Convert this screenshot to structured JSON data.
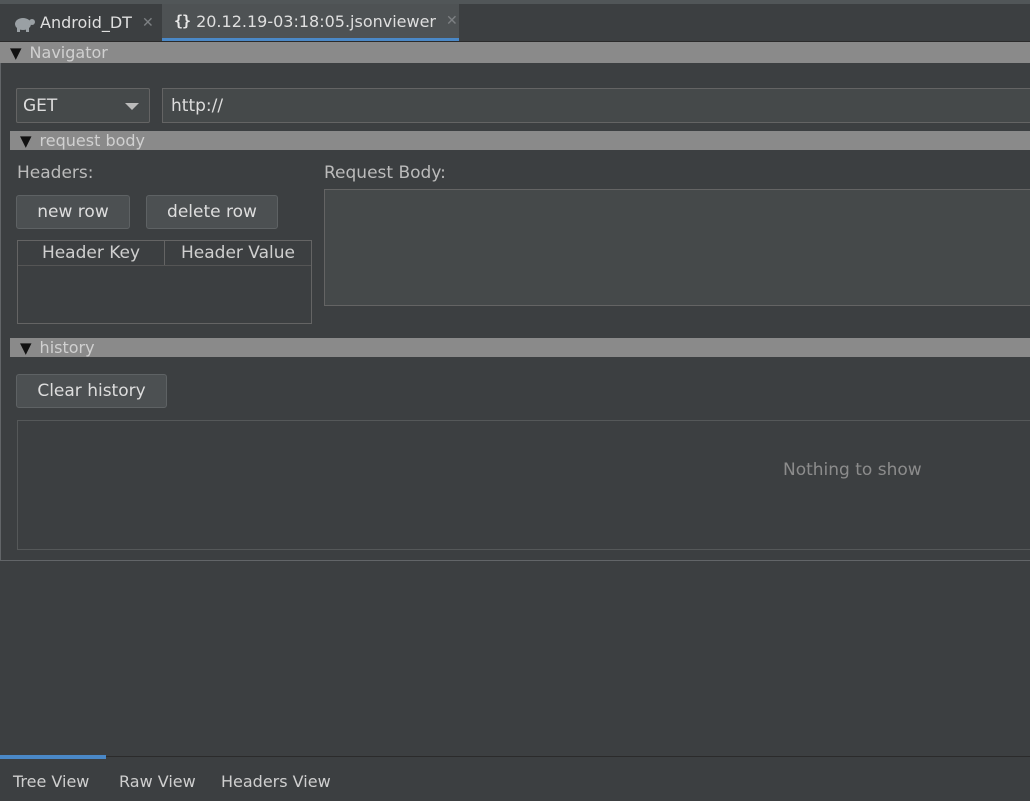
{
  "tabs": [
    {
      "label": "Android_DT",
      "icon": "android-turtle-icon",
      "active": false
    },
    {
      "label": "20.12.19-03:18:05.jsonviewer",
      "icon": "json-braces-icon",
      "active": true
    }
  ],
  "navigator": {
    "title": "Navigator"
  },
  "request": {
    "method": "GET",
    "url": "http://"
  },
  "request_body_section": {
    "title": "request body",
    "headers_label": "Headers:",
    "new_row": "new row",
    "delete_row": "delete row",
    "columns": [
      "Header Key",
      "Header Value"
    ],
    "body_label": "Request Body:"
  },
  "history": {
    "title": "history",
    "clear_label": "Clear history",
    "empty_text": "Nothing to show"
  },
  "bottom_tabs": [
    "Tree View",
    "Raw View",
    "Headers View"
  ],
  "colors": {
    "accent": "#4a88c7",
    "background": "#3c3f41",
    "section_bar": "#8a8a8a"
  }
}
